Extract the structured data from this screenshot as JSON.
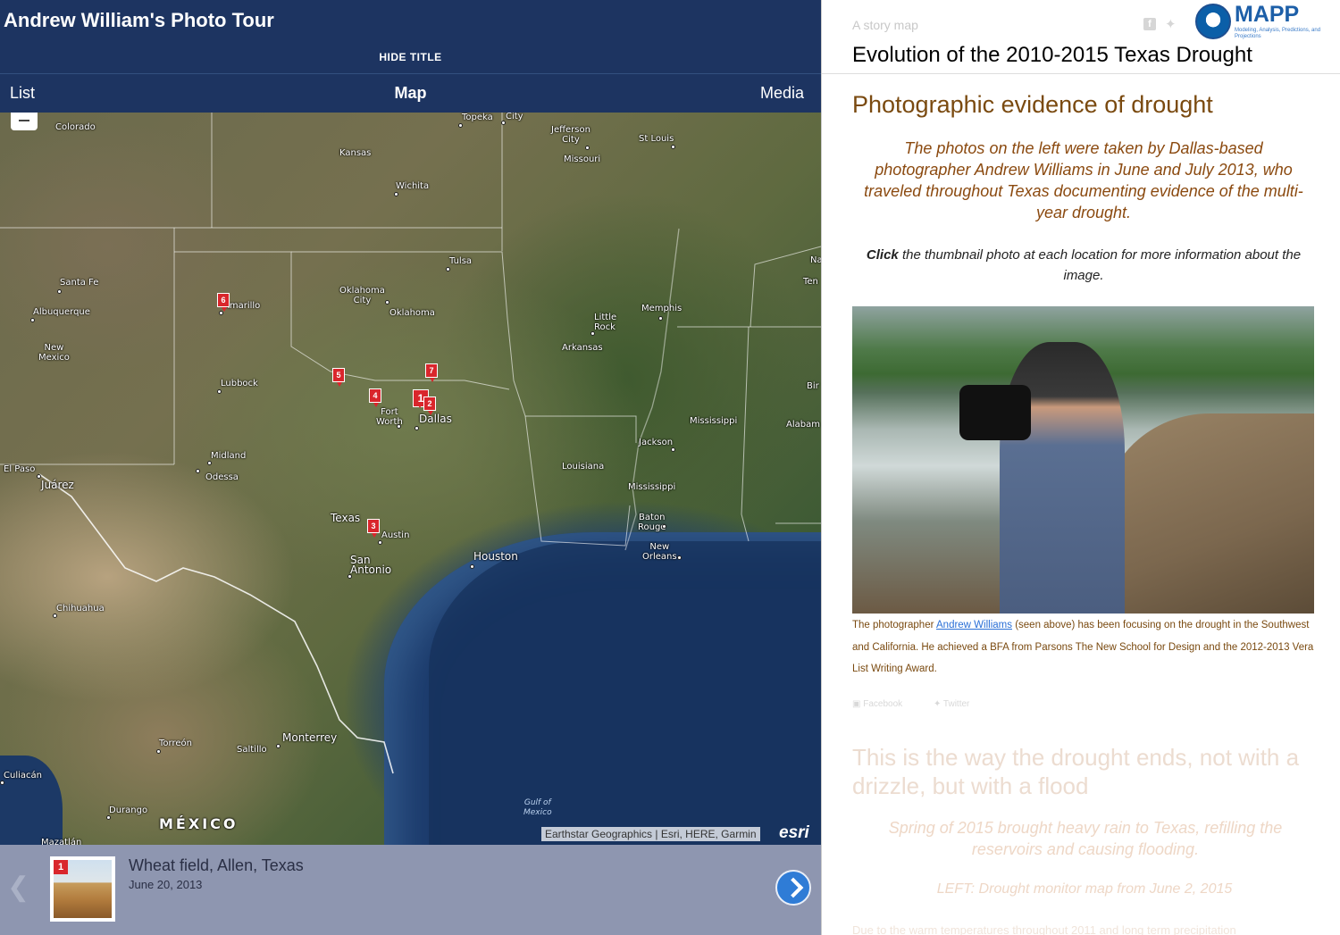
{
  "left": {
    "tour_title": "Andrew William's Photo Tour",
    "hide_title": "HIDE TITLE",
    "tabs": {
      "list": "List",
      "map": "Map",
      "media": "Media"
    },
    "map": {
      "labels": {
        "colorado": "Colorado",
        "topeka": "Topeka",
        "city": "City",
        "jefferson_city": "Jefferson\nCity",
        "st_louis": "St Louis",
        "missouri": "Missouri",
        "kansas": "Kansas",
        "wichita": "Wichita",
        "tulsa": "Tulsa",
        "santa_fe": "Santa Fe",
        "albuquerque": "Albuquerque",
        "amarillo": "Amarillo",
        "oklahoma_city": "Oklahoma\nCity",
        "oklahoma": "Oklahoma",
        "little_rock": "Little\nRock",
        "memphis": "Memphis",
        "arkansas": "Arkansas",
        "new_mexico": "New\nMexico",
        "lubbock": "Lubbock",
        "fort_worth": "Fort\nWorth",
        "dallas": "Dallas",
        "mississippi_state": "Mississippi",
        "alabama": "Alabam",
        "birmingham": "Bir",
        "nashville": "Na",
        "tennessee": "Ten",
        "midland": "Midland",
        "odessa": "Odessa",
        "el_paso": "El Paso",
        "juarez": "Juárez",
        "jackson": "Jackson",
        "louisiana": "Louisiana",
        "mississippi_river": "Mississippi",
        "texas": "Texas",
        "austin": "Austin",
        "baton_rouge": "Baton\nRouge",
        "new_orleans": "New\nOrleans",
        "houston": "Houston",
        "san_antonio": "San\nAntonio",
        "chihuahua": "Chihuahua",
        "torreon": "Torreón",
        "saltillo": "Saltillo",
        "monterrey": "Monterrey",
        "culiacan": "Culiacán",
        "durango": "Durango",
        "mexico": "MÉXICO",
        "mazatlan": "Mazatlán",
        "gulf": "Gulf of\nMexico"
      },
      "pins": [
        "1",
        "3",
        "4",
        "5",
        "6",
        "7",
        "2"
      ],
      "attribution": "Earthstar Geographics | Esri, HERE, Garmin",
      "esri_logo": "esri"
    },
    "carousel": {
      "item_number": "1",
      "title": "Wheat field, Allen, Texas",
      "date": "June 20, 2013"
    }
  },
  "right": {
    "story_label": "A story map",
    "share_icons": [
      "facebook-icon",
      "twitter-icon"
    ],
    "logo": {
      "text": "MAPP",
      "subtitle": "Modeling, Analysis, Predictions, and Projections"
    },
    "story_title": "Evolution of the 2010-2015 Texas Drought",
    "section_heading": "Photographic evidence of drought",
    "intro": "The photos on the left were taken by Dallas-based photographer Andrew Williams in June and July 2013, who traveled throughout Texas documenting evidence of the multi-year drought.",
    "click_bold": "Click",
    "click_rest": " the thumbnail photo at each location for more information about the image.",
    "caption_before": "The photographer ",
    "caption_link": "Andrew Williams",
    "caption_after": " (seen above) has been focusing on the drought in the Southwest and California. He achieved a BFA from Parsons The New School for Design and the 2012-2013 Vera List Writing Award.",
    "share_facebook": "Facebook",
    "share_twitter": "Twitter",
    "next_heading": "This is the way the drought ends, not with a drizzle, but with a flood",
    "next_intro": "Spring of 2015 brought heavy rain to Texas, refilling the reservoirs and causing flooding.",
    "next_left": "LEFT: Drought monitor map from June 2, 2015",
    "next_body": "Due to the warm temperatures throughout 2011 and long term precipitation"
  },
  "colors": {
    "header_bg": "#1d3461",
    "pin_red": "#d9262c",
    "heading_brown": "#7a4a10",
    "carousel_bg": "#8e96b0"
  }
}
